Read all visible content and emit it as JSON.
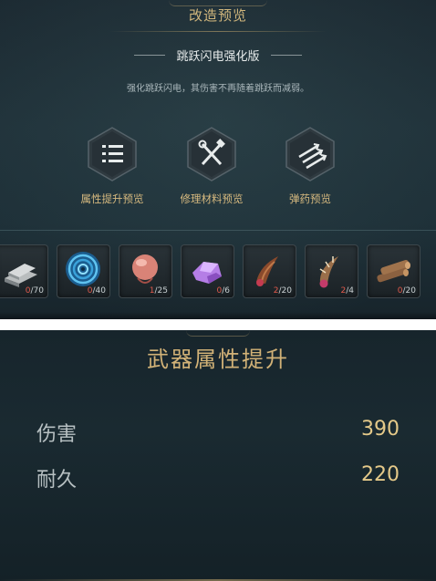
{
  "top_panel": {
    "header_title": "改造预览",
    "sub_title": "跳跃闪电强化版",
    "description": "强化跳跃闪电，其伤害不再随着跳跃而减弱。",
    "features": [
      {
        "label": "属性提升预览",
        "icon": "list-icon"
      },
      {
        "label": "修理材料预览",
        "icon": "repair-tools-icon"
      },
      {
        "label": "弹药预览",
        "icon": "arrows-icon"
      }
    ],
    "materials": [
      {
        "icon": "metal-ingot-icon",
        "have": "0",
        "need": "/70"
      },
      {
        "icon": "blue-vortex-orb-icon",
        "have": "0",
        "need": "/40"
      },
      {
        "icon": "flesh-orb-icon",
        "have": "1",
        "need": "/25"
      },
      {
        "icon": "purple-crystal-icon",
        "have": "0",
        "need": "/6"
      },
      {
        "icon": "horn-icon",
        "have": "2",
        "need": "/20"
      },
      {
        "icon": "spiked-tentacle-icon",
        "have": "2",
        "need": "/4"
      },
      {
        "icon": "wood-logs-icon",
        "have": "0",
        "need": "/20"
      }
    ]
  },
  "bottom_panel": {
    "title": "武器属性提升",
    "stats": [
      {
        "name": "伤害",
        "value": "390"
      },
      {
        "name": "耐久",
        "value": "220"
      }
    ]
  },
  "colors": {
    "gold_text": "#d2b277",
    "panel_bg": "#1c2a32",
    "count_red": "#e05a4c"
  }
}
